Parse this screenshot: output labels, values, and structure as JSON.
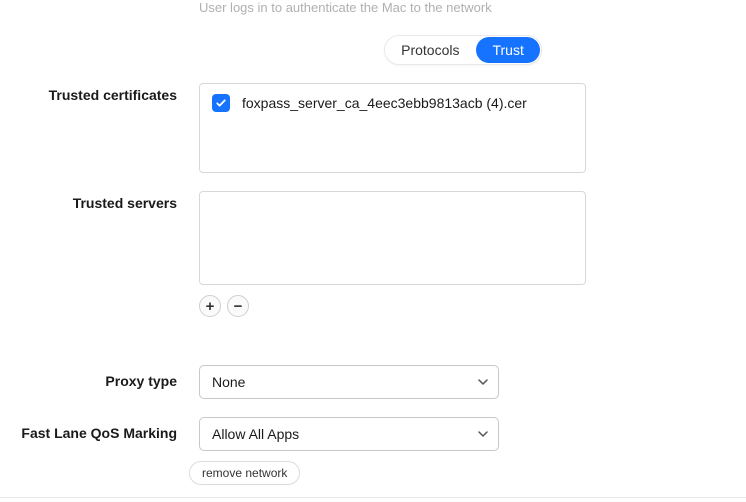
{
  "hint": "User logs in to authenticate the Mac to the network",
  "tabs": {
    "protocols": "Protocols",
    "trust": "Trust"
  },
  "labels": {
    "trusted_certificates": "Trusted certificates",
    "trusted_servers": "Trusted servers",
    "proxy_type": "Proxy type",
    "fast_lane": "Fast Lane QoS Marking"
  },
  "certificates": {
    "items": [
      {
        "label": "foxpass_server_ca_4eec3ebb9813acb (4).cer",
        "checked": true
      }
    ]
  },
  "icons": {
    "add": "+",
    "remove": "−"
  },
  "proxy": {
    "selected": "None"
  },
  "fastlane": {
    "selected": "Allow All Apps"
  },
  "actions": {
    "remove_network": "remove network"
  }
}
